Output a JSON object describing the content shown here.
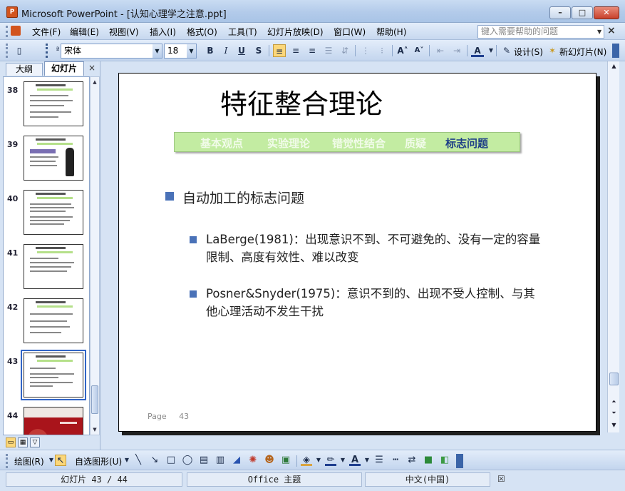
{
  "window": {
    "title": "Microsoft PowerPoint - [认知心理学之注意.ppt]",
    "icon_name": "powerpoint-icon",
    "app_glyph": "P"
  },
  "menu": {
    "items": [
      "文件(F)",
      "编辑(E)",
      "视图(V)",
      "插入(I)",
      "格式(O)",
      "工具(T)",
      "幻灯片放映(D)",
      "窗口(W)",
      "帮助(H)"
    ],
    "help_placeholder": "键入需要帮助的问题"
  },
  "format_toolbar": {
    "font_name": "宋体",
    "font_size": "18",
    "bold": "B",
    "italic": "I",
    "underline": "U",
    "shadow": "S",
    "design_label": "设计(S)",
    "new_slide_label": "新幻灯片(N)"
  },
  "left_pane": {
    "tab_outline": "大纲",
    "tab_slides": "幻灯片",
    "close": "×",
    "thumbnails": [
      {
        "num": "38",
        "selected": false
      },
      {
        "num": "39",
        "selected": false
      },
      {
        "num": "40",
        "selected": false
      },
      {
        "num": "41",
        "selected": false
      },
      {
        "num": "42",
        "selected": false
      },
      {
        "num": "43",
        "selected": true
      },
      {
        "num": "44",
        "selected": false
      }
    ]
  },
  "slide": {
    "title": "特征整合理论",
    "nav": [
      "基本观点",
      "实验理论",
      "错觉性结合",
      "质疑",
      "标志问题"
    ],
    "nav_active_index": 4,
    "bullet1": "自动加工的标志问题",
    "bullet2": [
      {
        "line1": "LaBerge(1981)：出现意识不到、不可避免的、没有一定的容量",
        "line2": "限制、高度有效性、难以改变"
      },
      {
        "line1": "Posner&Snyder(1975)：意识不到的、出现不受人控制、与其",
        "line2": "他心理活动不发生干扰"
      }
    ],
    "footer_label": "Page",
    "footer_num": "43"
  },
  "draw_toolbar": {
    "draw_label": "绘图(R)",
    "autoshape_label": "自选图形(U)"
  },
  "status": {
    "slide_info": "幻灯片 43 / 44",
    "theme": "Office 主题",
    "language": "中文(中国)"
  },
  "colors": {
    "accent_blue": "#4a72b8",
    "nav_green": "#c3eca2",
    "nav_active": "#1e3f87",
    "nav_inactive": "#f1fbe9",
    "selection": "#3165c6"
  }
}
